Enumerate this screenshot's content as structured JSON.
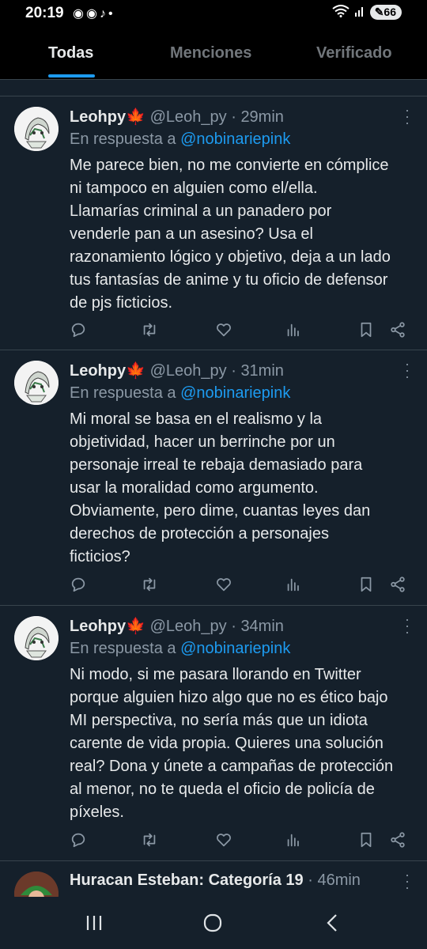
{
  "status_bar": {
    "time": "20:19",
    "battery": "66",
    "left_icons": [
      "discord-icon",
      "discord-icon",
      "tiktok-icon",
      "dot-icon"
    ]
  },
  "tabs": [
    {
      "label": "Todas",
      "active": true
    },
    {
      "label": "Menciones",
      "active": false
    },
    {
      "label": "Verificado",
      "active": false
    }
  ],
  "tweets": [
    {
      "name": "Leohpy",
      "emoji": "🍁",
      "handle": "@Leoh_py",
      "sep": "·",
      "time": "29min",
      "reply_prefix": "En respuesta a",
      "reply_to": "@nobinariepink",
      "lines": [
        "Me parece bien, no me convierte en cómplice",
        "ni tampoco en alguien como el/ella.",
        "Llamarías criminal a un panadero por",
        "venderle pan a un asesino? Usa el",
        "razonamiento lógico y objetivo, deja a un lado",
        "tus fantasías de anime y tu oficio de defensor",
        "de pjs ficticios."
      ]
    },
    {
      "name": "Leohpy",
      "emoji": "🍁",
      "handle": "@Leoh_py",
      "sep": "·",
      "time": "31min",
      "reply_prefix": "En respuesta a",
      "reply_to": "@nobinariepink",
      "lines": [
        "Mi moral se basa en el realismo y la",
        "objetividad, hacer un berrinche por un",
        "personaje irreal te rebaja demasiado para",
        "usar la moralidad como argumento.",
        "Obviamente, pero dime, cuantas leyes dan",
        "derechos de protección a personajes",
        "ficticios?"
      ]
    },
    {
      "name": "Leohpy",
      "emoji": "🍁",
      "handle": "@Leoh_py",
      "sep": "·",
      "time": "34min",
      "reply_prefix": "En respuesta a",
      "reply_to": "@nobinariepink",
      "lines": [
        "Ni modo, si me pasara llorando en Twitter",
        "porque alguien hizo algo que no es ético bajo",
        "MI perspectiva, no sería más que un idiota",
        "carente de vida propia. Quieres una solución",
        "real? Dona y únete a campañas de protección",
        "al menor, no te queda el oficio de policía de",
        "píxeles."
      ]
    }
  ],
  "partial_tweet": {
    "name": "Huracan Esteban: Categoría 19",
    "sep": "·",
    "time": "46min"
  },
  "action_icons": [
    "reply-icon",
    "retweet-icon",
    "like-icon",
    "views-icon",
    "bookmark-icon",
    "share-icon"
  ],
  "colors": {
    "background": "#15202b",
    "accent": "#1d9bf0",
    "muted": "#8b98a5",
    "text": "#e7e9ea",
    "divider": "#38444d"
  }
}
